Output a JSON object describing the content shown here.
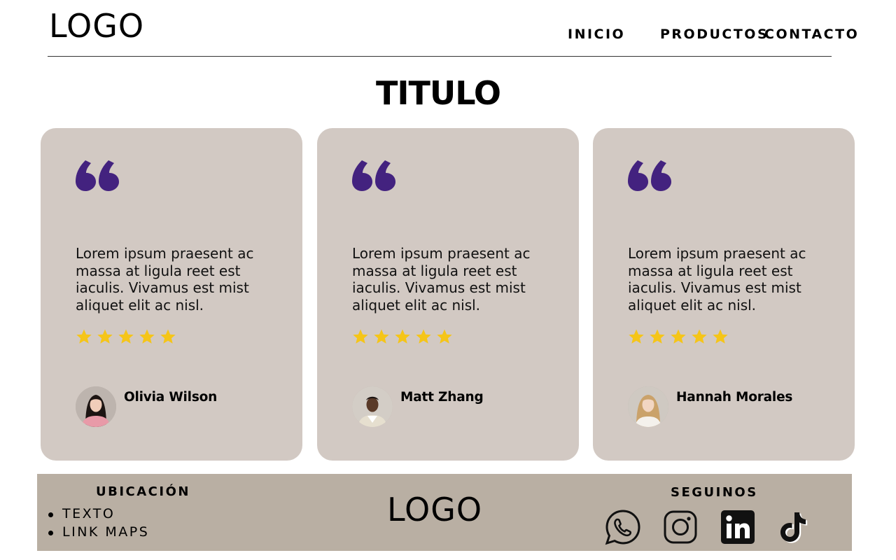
{
  "header": {
    "logo": "LOGO",
    "nav": [
      {
        "label": "INICIO"
      },
      {
        "label": "PRODUCTOS"
      },
      {
        "label": "CONTACTO"
      }
    ]
  },
  "main": {
    "title": "TITULO",
    "testimonials": [
      {
        "text": "Lorem ipsum praesent ac massa at ligula reet est iaculis. Vivamus est mist aliquet elit ac nisl.",
        "rating": 5,
        "name": "Olivia Wilson"
      },
      {
        "text": "Lorem ipsum praesent ac massa at ligula reet est iaculis. Vivamus est mist aliquet elit ac nisl.",
        "rating": 5,
        "name": "Matt Zhang"
      },
      {
        "text": "Lorem ipsum praesent ac massa at ligula reet est iaculis. Vivamus est mist aliquet elit ac nisl.",
        "rating": 5,
        "name": "Hannah Morales"
      }
    ]
  },
  "footer": {
    "location_title": "UBICACIÓN",
    "location_items": [
      "TEXTO",
      "LINK MAPS"
    ],
    "logo": "LOGO",
    "social_title": "SEGUINOS",
    "social_icons": [
      "whatsapp-icon",
      "instagram-icon",
      "linkedin-icon",
      "tiktok-icon"
    ]
  },
  "colors": {
    "card_bg": "#d2c9c3",
    "footer_bg": "#b9afa3",
    "quote_accent": "#43227f",
    "star": "#f5c518"
  }
}
